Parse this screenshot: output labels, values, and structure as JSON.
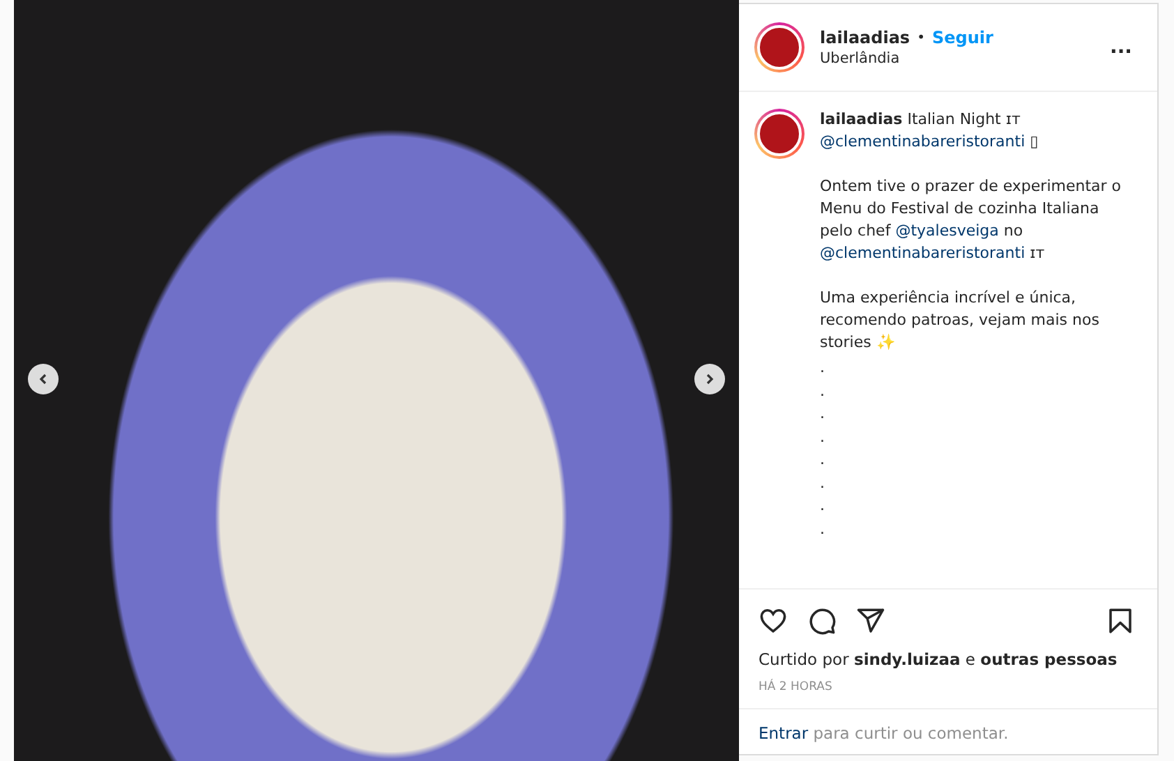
{
  "post": {
    "nav": {
      "previous": true,
      "next": true
    }
  },
  "header": {
    "username": "lailaadias",
    "separator": "•",
    "follow": "Seguir",
    "location": "Uberlândia",
    "more": "..."
  },
  "caption": {
    "paragraphs": [
      {
        "segments": [
          {
            "kind": "username",
            "text": "lailaadias"
          },
          {
            "kind": "text",
            "text": " Italian Night ɪᴛ\n"
          },
          {
            "kind": "mention",
            "text": "@clementinabareristoranti"
          },
          {
            "kind": "text",
            "text": " ▯"
          }
        ]
      },
      {
        "segments": [
          {
            "kind": "text",
            "text": "Ontem tive o prazer de experimentar o Menu do Festival de cozinha Italiana pelo chef "
          },
          {
            "kind": "mention",
            "text": "@tyalesveiga"
          },
          {
            "kind": "text",
            "text": " no\n"
          },
          {
            "kind": "mention",
            "text": "@clementinabareristoranti"
          },
          {
            "kind": "text",
            "text": " ɪᴛ"
          }
        ]
      },
      {
        "segments": [
          {
            "kind": "text",
            "text": "Uma experiência incrível e única, recomendo patroas, vejam mais nos stories ✨"
          }
        ]
      }
    ],
    "dots": [
      ".",
      ".",
      ".",
      ".",
      ".",
      ".",
      ".",
      "."
    ]
  },
  "likes": {
    "prefix": "Curtido por ",
    "user": "sindy.luizaa",
    "middle": " e ",
    "others": "outras pessoas"
  },
  "time": "HÁ 2 HORAS",
  "login": {
    "link": "Entrar",
    "rest": " para curtir ou comentar."
  }
}
